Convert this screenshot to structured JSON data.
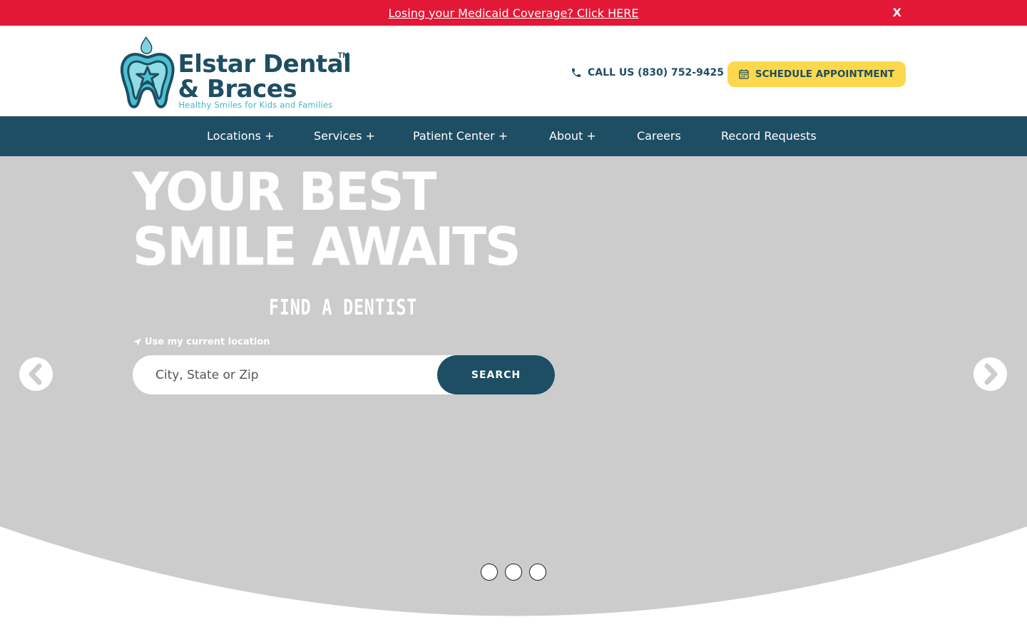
{
  "alert": {
    "link_text": "Losing your Medicaid Coverage? Click HERE ",
    "close_label": "X"
  },
  "logo": {
    "line1": "Elstar Dental",
    "tm": "TM",
    "line2": "& Braces",
    "tagline": "Healthy Smiles for Kids and Families"
  },
  "header": {
    "call_label": "CALL US (830) 752-9425",
    "schedule_label": "SCHEDULE APPOINTMENT"
  },
  "nav": {
    "items": [
      {
        "label": "Locations +"
      },
      {
        "label": "Services +"
      },
      {
        "label": "Patient Center +"
      },
      {
        "label": "About +"
      },
      {
        "label": "Careers"
      },
      {
        "label": "Record Requests"
      }
    ]
  },
  "hero": {
    "title_line1": "YOUR BEST",
    "title_line2": "SMILE AWAITS",
    "find_dentist": "FIND A DENTIST",
    "use_location": "Use my current location",
    "search_placeholder": "City, State or Zip",
    "search_button": "SEARCH"
  },
  "carousel": {
    "slide_count": 3
  },
  "colors": {
    "alert_red": "#e31837",
    "brand_navy": "#1e4e63",
    "accent_yellow": "#fdd84c",
    "accent_teal": "#3fb6c8",
    "hero_gray": "#cccccc"
  },
  "icons": {
    "phone": "phone-icon",
    "calendar": "calendar-icon",
    "location": "location-arrow-icon",
    "prev": "chevron-left-icon",
    "next": "chevron-right-icon"
  }
}
